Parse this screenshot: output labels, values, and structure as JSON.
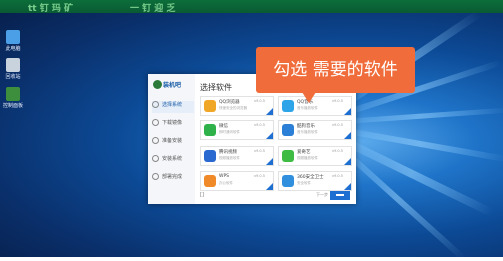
{
  "top_strip": {
    "left_text": "tt 钉 玛 矿",
    "right_text": "一 钉 迎 乏"
  },
  "desktop_icons": [
    {
      "label": "此电脑",
      "icon": "computer-icon",
      "color": "#4a9fe6"
    },
    {
      "label": "回收站",
      "icon": "recycle-bin-icon",
      "color": "#c9d3de"
    },
    {
      "label": "控制面板",
      "icon": "control-panel-icon",
      "color": "#3d8f3e"
    }
  ],
  "installer": {
    "logo_text": "装机吧",
    "title": "选择软件",
    "window_controls": "— ×",
    "steps": [
      {
        "label": "选择系统",
        "active": true
      },
      {
        "label": "下载镜像",
        "active": false
      },
      {
        "label": "准备安装",
        "active": false
      },
      {
        "label": "安装系统",
        "active": false
      },
      {
        "label": "部署完成",
        "active": false
      }
    ],
    "software": [
      {
        "name": "QQ浏览器",
        "desc": "快速安全的浏览器",
        "version": "v9.0.5",
        "icon_color": "#f0a627"
      },
      {
        "name": "QQ音乐",
        "desc": "音乐播放软件",
        "version": "v9.0.5",
        "icon_color": "#2ea5e8"
      },
      {
        "name": "微信",
        "desc": "即时通讯软件",
        "version": "v9.0.5",
        "icon_color": "#2fb24a"
      },
      {
        "name": "酷狗音乐",
        "desc": "音乐播放软件",
        "version": "v9.0.5",
        "icon_color": "#2c7fd6"
      },
      {
        "name": "腾讯视频",
        "desc": "视频播放软件",
        "version": "v9.0.5",
        "icon_color": "#2a6ad0"
      },
      {
        "name": "爱奇艺",
        "desc": "视频播放软件",
        "version": "v9.0.5",
        "icon_color": "#3dbb43"
      },
      {
        "name": "WPS",
        "desc": "办公软件",
        "version": "v9.0.5",
        "icon_color": "#f08a28"
      },
      {
        "name": "360安全卫士",
        "desc": "安全软件",
        "version": "v9.0.5",
        "icon_color": "#3090dd"
      }
    ],
    "footer_left": "[]",
    "footer_right": "下一步"
  },
  "callout": {
    "text": "勾选 需要的软件",
    "color": "#f06d3b"
  }
}
